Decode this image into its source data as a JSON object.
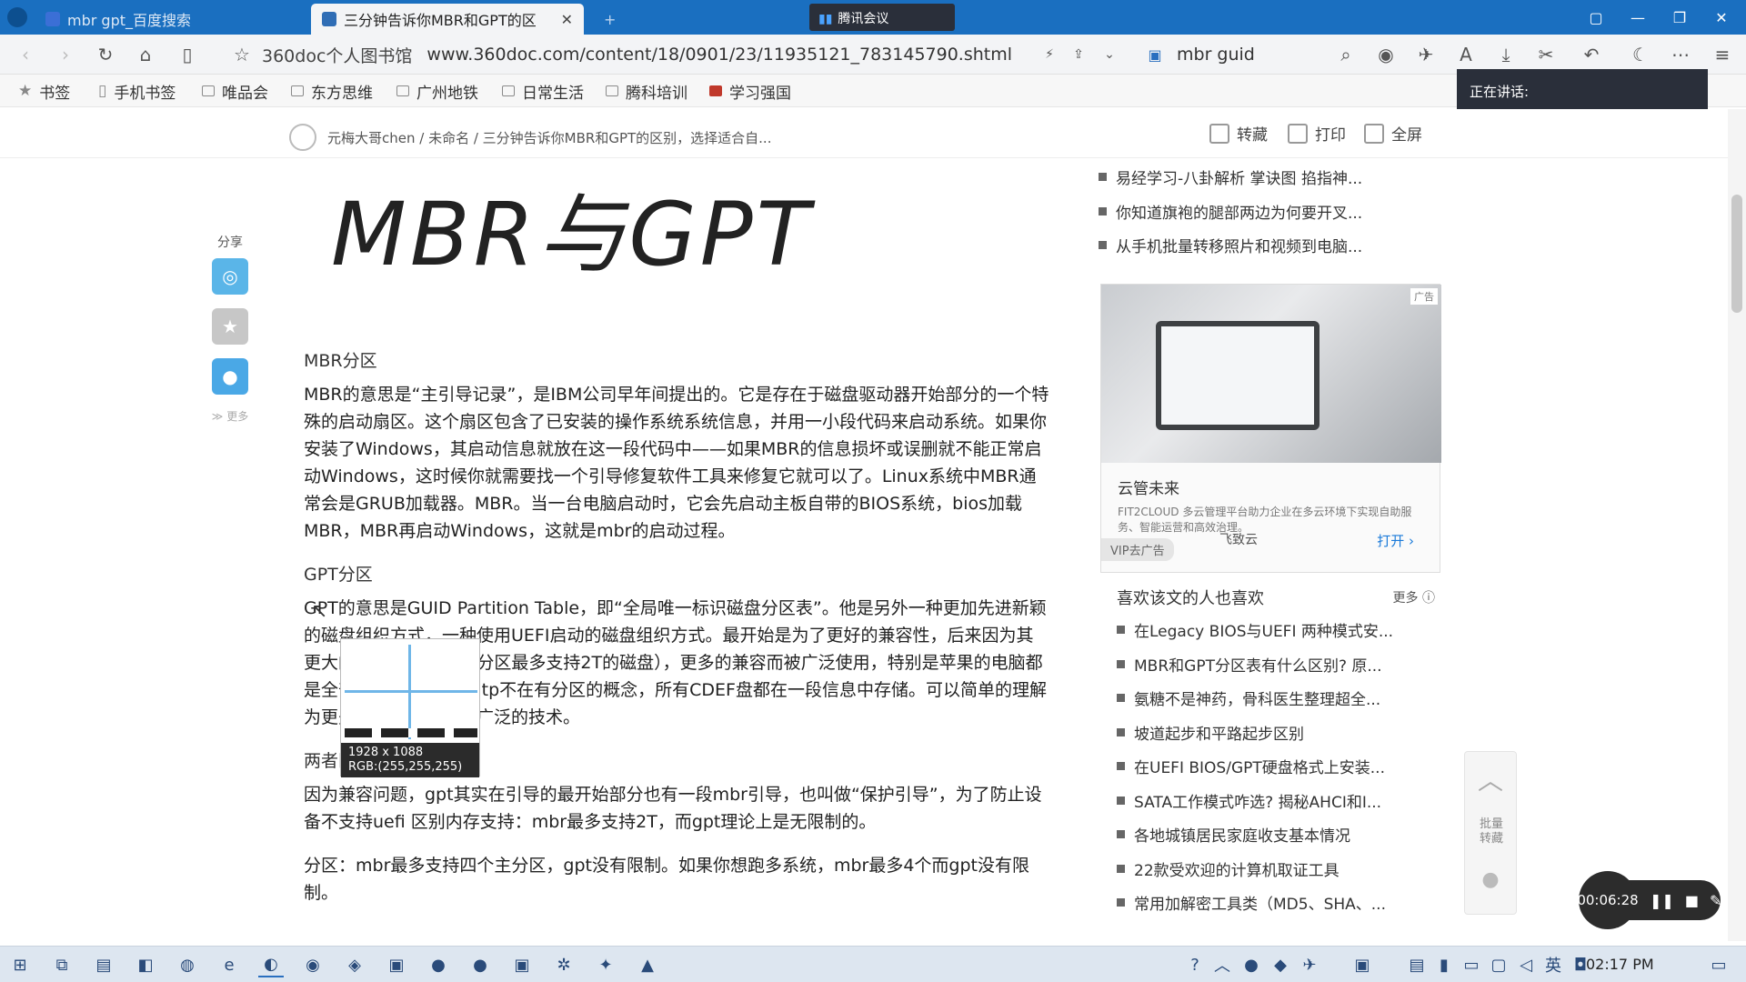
{
  "tabs": [
    {
      "title": "mbr gpt_百度搜索",
      "active": false
    },
    {
      "title": "三分钟告诉你MBR和GPT的区",
      "active": true
    },
    {
      "title": "+",
      "active": false
    }
  ],
  "meeting_tab": "腾讯会议",
  "address_site": "360doc个人图书馆",
  "address_url": "www.360doc.com/content/18/0901/23/11935121_783145790.shtml",
  "search_text": "mbr guid",
  "speaking_label": "正在讲话:",
  "bookmarks": [
    "书签",
    "手机书签",
    "唯品会",
    "东方思维",
    "广州地铁",
    "日常生活",
    "腾科培训",
    "学习强国"
  ],
  "breadcrumb": "元梅大哥chen / 未命名 / 三分钟告诉你MBR和GPT的区别，选择适合自...",
  "header_actions": {
    "save": "转藏",
    "print": "打印",
    "fullscreen": "全屏"
  },
  "share": {
    "label": "分享",
    "more": "更多"
  },
  "article": {
    "big_title": "MBR与GPT",
    "h_mbr": "MBR分区",
    "p_mbr": "MBR的意思是“主引导记录”，是IBM公司早年间提出的。它是存在于磁盘驱动器开始部分的一个特殊的启动扇区。这个扇区包含了已安装的操作系统系统信息，并用一小段代码来启动系统。如果你安装了Windows，其启动信息就放在这一段代码中——如果MBR的信息损坏或误删就不能正常启动Windows，这时候你就需要找一个引导修复软件工具来修复它就可以了。Linux系统中MBR通常会是GRUB加载器。MBR。当一台电脑启动时，它会先启动主板自带的BIOS系统，bios加载MBR，MBR再启动Windows，这就是mbr的启动过程。",
    "h_gpt": "GPT分区",
    "p_gpt": "GPT的意思是GUID Partition Table，即“全局唯一标识磁盘分区表”。他是另外一种更加先进新颖的磁盘组织方式，一种使用UEFI启动的磁盘组织方式。最开始是为了更好的兼容性，后来因为其更大的支持内存（mbr分区最多支持2T的磁盘），更多的兼容而被广泛使用，特别是苹果的电脑都是全部使用gpt分区。gtp不在有分区的概念，所有CDEF盘都在一段信息中存储。可以简单的理解为更先进但是使用不够广泛的技术。",
    "h_diff": "两者区别",
    "p_diff1": "因为兼容问题，gpt其实在引导的最开始部分也有一段mbr引导，也叫做“保护引导”，为了防止设备不支持uefi 区别内存支持：mbr最多支持2T，而gpt理论上是无限制的。",
    "p_diff2": "分区：mbr最多支持四个主分区，gpt没有限制。如果你想跑多系统，mbr最多4个而gpt没有限制。"
  },
  "magnifier": {
    "size": "1928 x 1088",
    "rgb": "RGB:(255,255,255)"
  },
  "right_top_list": [
    "易经学习-八卦解析 掌诀图 掐指神...",
    "你知道旗袍的腿部两边为何要开叉...",
    "从手机批量转移照片和视频到电脑..."
  ],
  "ad": {
    "tag": "广告",
    "title": "云管未来",
    "desc": "FIT2CLOUD 多云管理平台助力企业在多云环境下实现自助服务、智能运营和高效治理。",
    "brand": "飞致云",
    "open": "打开",
    "vip": "VIP去广告"
  },
  "like_header": "喜欢该文的人也喜欢",
  "like_more": "更多",
  "like_list": [
    "在Legacy BIOS与UEFI 两种模式安...",
    "MBR和GPT分区表有什么区别? 原...",
    "氨糖不是神药，骨科医生整理超全...",
    "坡道起步和平路起步区别",
    "在UEFI BIOS/GPT硬盘格式上安装...",
    "SATA工作模式咋选? 揭秘AHCI和I...",
    "各地城镇居民家庭收支基本情况",
    "22款受欢迎的计算机取证工具",
    "常用加解密工具类（MD5、SHA、..."
  ],
  "side_float": {
    "save": "批量转藏"
  },
  "timer": "00:06:28",
  "clock": "02:17 PM",
  "colors": {
    "titlebar": "#1a6fc0",
    "taskbar": "#dde6f0",
    "link": "#1a7ad9"
  }
}
